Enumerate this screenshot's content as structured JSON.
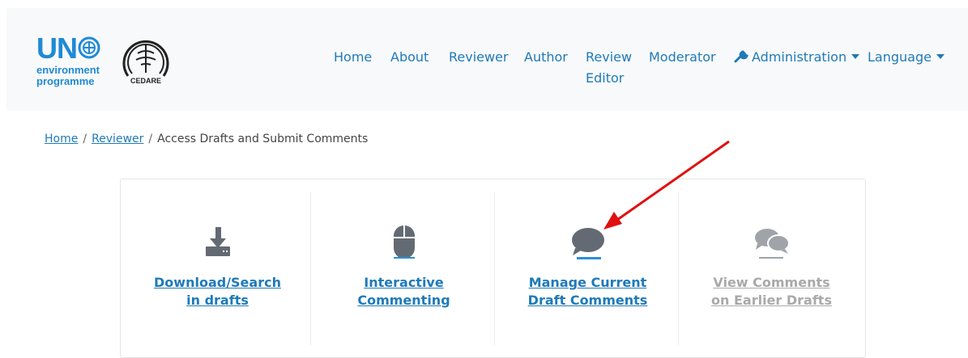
{
  "logos": {
    "un_letters": "UN",
    "un_line1": "environment",
    "un_line2": "programme",
    "cedare_text": "CEDARE"
  },
  "nav": {
    "home": "Home",
    "about": "About",
    "reviewer": "Reviewer",
    "author": "Author",
    "review_editor_line1": "Review",
    "review_editor_line2": "Editor",
    "moderator": "Moderator",
    "administration": "Administration",
    "language": "Language"
  },
  "breadcrumb": {
    "home": "Home",
    "reviewer": "Reviewer",
    "current": "Access Drafts and Submit Comments",
    "separator": "/"
  },
  "tiles": [
    {
      "icon": "download-icon",
      "line1": "Download/Search",
      "line2": "in drafts",
      "enabled": true
    },
    {
      "icon": "mouse-icon",
      "line1": "Interactive",
      "line2": "Commenting",
      "enabled": true
    },
    {
      "icon": "comment-icon",
      "line1": "Manage Current",
      "line2": "Draft Comments",
      "enabled": true
    },
    {
      "icon": "comments-icon",
      "line1": "View Comments",
      "line2": "on Earlier Drafts",
      "enabled": false
    }
  ],
  "colors": {
    "link": "#1f7ab8",
    "un_blue": "#1f8ad6",
    "icon_gray": "#646a73",
    "icon_accent": "#2a8fd6",
    "muted": "#a9a9a9",
    "annotation_arrow": "#e01010",
    "navbar_bg": "#f8f9fa"
  }
}
